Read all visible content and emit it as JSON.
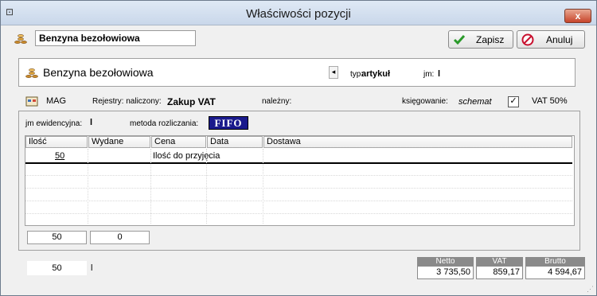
{
  "window": {
    "title": "Właściwości pozycji",
    "close_label": "x",
    "sysmenu_label": "⊡"
  },
  "top": {
    "name_value": "Benzyna bezołowiowa",
    "save_label": "Zapisz",
    "cancel_label": "Anuluj"
  },
  "header": {
    "item_name": "Benzyna bezołowiowa",
    "scroll_arrow": "◂",
    "type_label": "typ:",
    "type_value": "artykuł",
    "unit_label": "jm:",
    "unit_value": "l"
  },
  "info": {
    "warehouse": "MAG",
    "registers_label": "Rejestry: naliczony:",
    "registers_value": "Zakup VAT",
    "due_label": "należny:",
    "booking_label": "księgowanie:",
    "booking_value": "schemat",
    "vat_label": "VAT 50%"
  },
  "inventory": {
    "unit_label": "jm ewidencyjna:",
    "unit_value": "l",
    "method_label": "metoda rozliczania:",
    "method_value": "FIFO"
  },
  "grid": {
    "columns": [
      "Ilość",
      "Wydane",
      "Cena",
      "Data",
      "Dostawa"
    ],
    "row1": {
      "qty": "50",
      "issued": "",
      "price": "Ilość do przyjęcia"
    }
  },
  "grid_totals": {
    "qty": "50",
    "issued": "0"
  },
  "bottom": {
    "qty": "50",
    "unit": "l"
  },
  "totals": {
    "net_label": "Netto",
    "net_value": "3 735,50",
    "vat_label": "VAT",
    "vat_value": "859,17",
    "gross_label": "Brutto",
    "gross_value": "4 594,67"
  },
  "colors": {
    "accent_check": "#2a9a2a",
    "cancel_red": "#c8102e",
    "fifo_bg": "#1a1a8c"
  }
}
